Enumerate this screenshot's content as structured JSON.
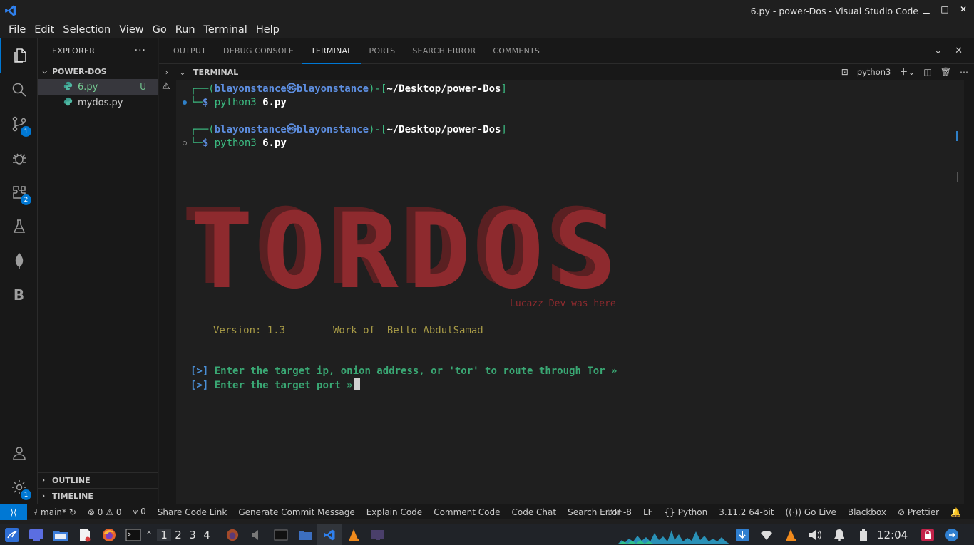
{
  "window": {
    "title": "6.py - power-Dos - Visual Studio Code"
  },
  "menu": [
    "File",
    "Edit",
    "Selection",
    "View",
    "Go",
    "Run",
    "Terminal",
    "Help"
  ],
  "activity": {
    "scm_badge": "1",
    "extensions_badge": "2",
    "blackbox_letter": "B",
    "settings_badge": "1"
  },
  "explorer": {
    "header": "EXPLORER",
    "folder": "POWER-DOS",
    "files": [
      {
        "name": "6.py",
        "status": "U"
      },
      {
        "name": "mydos.py",
        "status": ""
      }
    ],
    "outline": "OUTLINE",
    "timeline": "TIMELINE"
  },
  "panel": {
    "tabs": [
      "OUTPUT",
      "DEBUG CONSOLE",
      "TERMINAL",
      "PORTS",
      "SEARCH ERROR",
      "COMMENTS"
    ],
    "active_tab": "TERMINAL",
    "terminal_title": "TERMINAL",
    "shell_name": "python3"
  },
  "terminal": {
    "prompt1": {
      "open": "┌──(",
      "user": "blayonstance",
      "at": "㉿",
      "host": "blayonstance",
      "mid": ")-[",
      "path": "~/Desktop/power-Dos",
      "close": "]",
      "arrow": "└─",
      "dollar": "$ ",
      "cmd": "python3",
      "arg": "6.py"
    },
    "prompt2": {
      "open": "┌──(",
      "user": "blayonstance",
      "at": "㉿",
      "host": "blayonstance",
      "mid": ")-[",
      "path": "~/Desktop/power-Dos",
      "close": "]",
      "arrow": "└─",
      "dollar": "$ ",
      "cmd": "python3",
      "arg": "6.py"
    },
    "banner": "TORDOS",
    "signature": "Lucazz Dev was here",
    "version": "Version: 1.3",
    "author": "Work of  Bello AbdulSamad",
    "prompt_marker": "[>]",
    "question1": "Enter the target ip, onion address, or 'tor' to route through Tor »",
    "question2": "Enter the target port »"
  },
  "statusbar": {
    "branch": "main*",
    "errors": "0",
    "warnings": "0",
    "ports": "0",
    "items": [
      "Share Code Link",
      "Generate Commit Message",
      "Explain Code",
      "Comment Code",
      "Code Chat",
      "Search Error"
    ],
    "encoding": "UTF-8",
    "eol": "LF",
    "language": "Python",
    "interpreter": "3.11.2 64-bit",
    "golive": "Go Live",
    "blackbox": "Blackbox",
    "prettier": "Prettier"
  },
  "taskbar": {
    "workspaces": [
      "1",
      "2",
      "3",
      "4"
    ],
    "clock": "12:04"
  },
  "colors": {
    "accent": "#0078d4",
    "banner": "#8e2a2e",
    "prompt_green": "#3cbc82",
    "prompt_blue": "#5d8ee0"
  }
}
